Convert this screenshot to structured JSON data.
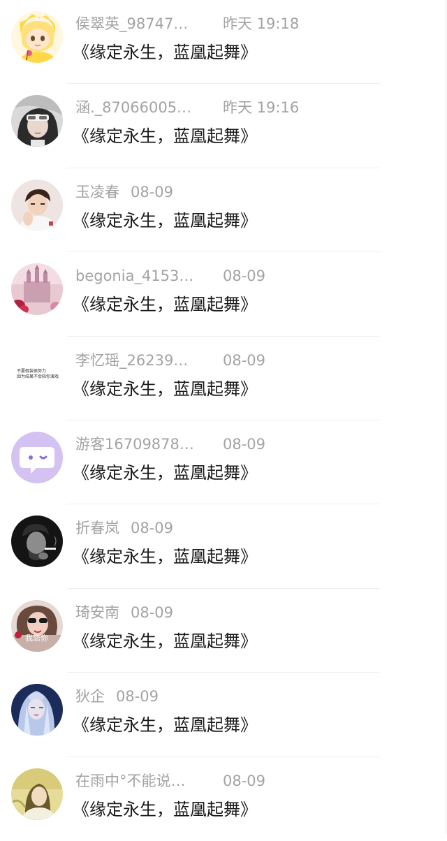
{
  "comments": [
    {
      "name": "侯翠英_98747…",
      "time": "昨天 19:18",
      "content": "《缘定永生，蓝凰起舞》",
      "avatar": "cartoon-blond-avatar",
      "layout": "long"
    },
    {
      "name": "涵._87066005…",
      "time": "昨天 19:16",
      "content": "《缘定永生，蓝凰起舞》",
      "avatar": "girl-mask-avatar",
      "layout": "long"
    },
    {
      "name": "玉凌春",
      "time": "08-09",
      "content": "《缘定永生，蓝凰起舞》",
      "avatar": "boy-avatar",
      "layout": "short"
    },
    {
      "name": "begonia_4153…",
      "time": "08-09",
      "content": "《缘定永生，蓝凰起舞》",
      "avatar": "pink-castle-avatar",
      "layout": "long"
    },
    {
      "name": "李忆瑶_26239…",
      "time": "08-09",
      "content": "《缘定永生，蓝凰起舞》",
      "avatar": "text-avatar",
      "avatar_text": [
        "不要假装很努力",
        "因为结果不会陪你演戏"
      ],
      "layout": "long"
    },
    {
      "name": "游客16709878…",
      "time": "08-09",
      "content": "《缘定永生，蓝凰起舞》",
      "avatar": "purple-chat-avatar",
      "layout": "long"
    },
    {
      "name": "折春岚",
      "time": "08-09",
      "content": "《缘定永生，蓝凰起舞》",
      "avatar": "smoking-man-avatar",
      "layout": "short"
    },
    {
      "name": "琦安南",
      "time": "08-09",
      "content": "《缘定永生，蓝凰起舞》",
      "avatar": "girl-sunglasses-avatar",
      "avatar_text": [
        "我恋你"
      ],
      "layout": "short"
    },
    {
      "name": "狄企",
      "time": "08-09",
      "content": "《缘定永生，蓝凰起舞》",
      "avatar": "anime-silver-hair-avatar",
      "layout": "short"
    },
    {
      "name": "在雨中°不能说…",
      "time": "08-09",
      "content": "《缘定永生，蓝凰起舞》",
      "avatar": "yellow-girl-avatar",
      "layout": "long"
    }
  ]
}
